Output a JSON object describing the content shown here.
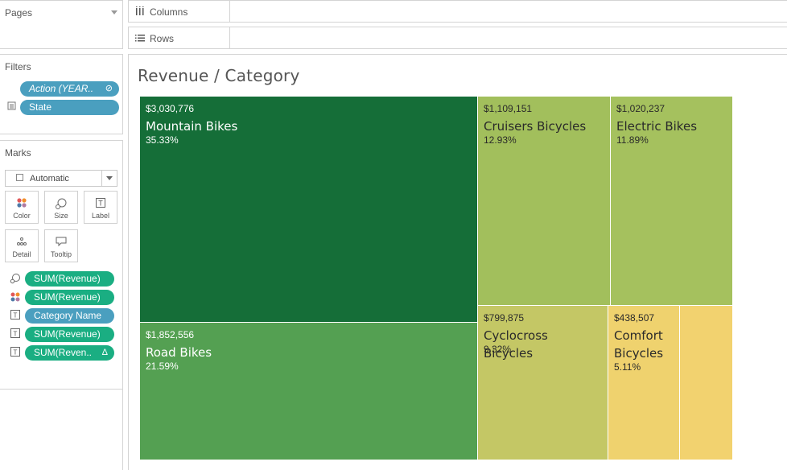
{
  "pages_card": {
    "title": "Pages"
  },
  "filters_card": {
    "title": "Filters",
    "pills": [
      {
        "label": "Action (YEAR..",
        "icon": "link-icon"
      },
      {
        "label": "State",
        "icon": "database-icon"
      }
    ]
  },
  "marks_card": {
    "title": "Marks",
    "mark_type": "Automatic",
    "buttons": [
      {
        "label": "Color",
        "icon": "color-dots-icon"
      },
      {
        "label": "Size",
        "icon": "size-circles-icon"
      },
      {
        "label": "Label",
        "icon": "text-label-icon"
      },
      {
        "label": "Detail",
        "icon": "detail-dots-icon"
      },
      {
        "label": "Tooltip",
        "icon": "speech-bubble-icon"
      }
    ],
    "pills": [
      {
        "label": "SUM(Revenue)",
        "type_icon": "size-icon",
        "color": "green"
      },
      {
        "label": "SUM(Revenue)",
        "type_icon": "color-icon",
        "color": "green"
      },
      {
        "label": "Category Name",
        "type_icon": "text-icon",
        "color": "blue"
      },
      {
        "label": "SUM(Revenue)",
        "type_icon": "text-icon",
        "color": "green"
      },
      {
        "label": "SUM(Reven..",
        "type_icon": "text-icon",
        "color": "green",
        "badge": "Δ"
      }
    ]
  },
  "shelves": {
    "columns": "Columns",
    "rows": "Rows"
  },
  "sheet": {
    "title": "Revenue / Category"
  },
  "treemap": {
    "tiles": [
      {
        "value": "$3,030,776",
        "name": "Mountain Bikes",
        "pct": "35.33%",
        "color": "#156e38"
      },
      {
        "value": "$1,852,556",
        "name": "Road Bikes",
        "pct": "21.59%",
        "color": "#54a052"
      },
      {
        "value": "$1,109,151",
        "name": "Cruisers Bicycles",
        "pct": "12.93%",
        "color": "#a2bf5c"
      },
      {
        "value": "$1,020,237",
        "name": "Electric Bikes",
        "pct": "11.89%",
        "color": "#a5c15e"
      },
      {
        "value": "$799,875",
        "name": "Cyclocross Bicycles",
        "pct": "9.32%",
        "color": "#c4c765"
      },
      {
        "value": "$438,507",
        "name": "Comfort Bicycles",
        "pct": "5.11%",
        "color": "#efd26e"
      },
      {
        "value": "",
        "name": "",
        "pct": "",
        "color": "#f2d26f"
      }
    ]
  }
}
